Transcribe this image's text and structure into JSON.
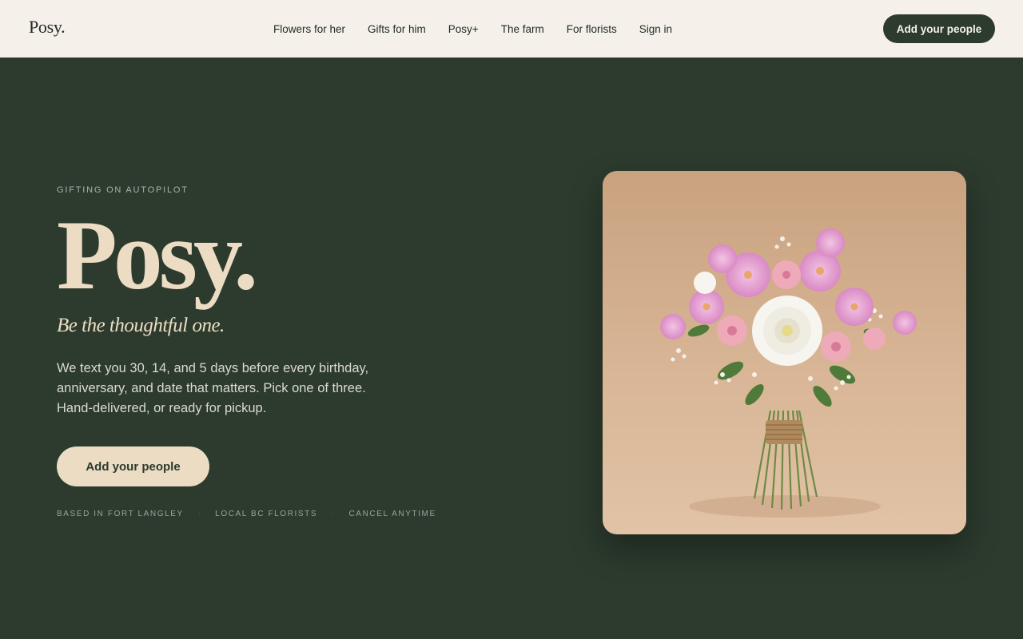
{
  "nav": {
    "logo": "Posy.",
    "links": [
      "Flowers for her",
      "Gifts for him",
      "Posy+",
      "The farm",
      "For florists",
      "Sign in"
    ],
    "cta": "Add your people"
  },
  "hero": {
    "eyebrow": "GIFTING ON AUTOPILOT",
    "title": "Posy.",
    "tagline": "Be the thoughtful one.",
    "description": "We text you 30, 14, and 5 days before every birthday, anniversary, and date that matters. Pick one of three. Hand-delivered, or ready for pickup.",
    "cta": "Add your people",
    "badges": [
      "BASED IN FORT LANGLEY",
      "LOCAL BC FLORISTS",
      "CANCEL ANYTIME"
    ],
    "separator": "·"
  },
  "colors": {
    "background": "#2c3b2e",
    "nav_background": "#f5f1ea",
    "cream": "#ecdcc3",
    "photo_backdrop": "#d8b596"
  },
  "icons": {
    "photo": "bouquet-photo"
  }
}
